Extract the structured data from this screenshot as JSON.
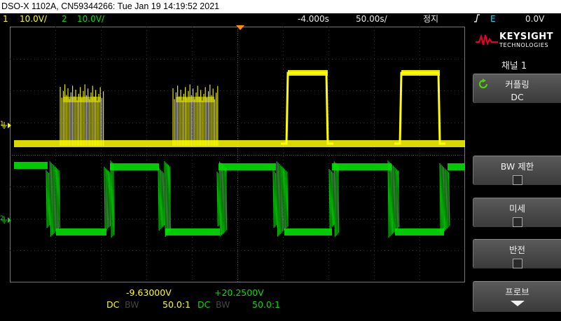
{
  "title": "DSO-X 1102A, CN59344266: Tue Jan 19 14:19:52 2021",
  "status": {
    "ch1_num": "1",
    "ch1_scale": "10.0V/",
    "ch2_num": "2",
    "ch2_scale": "10.0V/",
    "time_offset": "-4.000s",
    "time_scale": "50.00s/",
    "run_state": "정지",
    "trigger_icon": "trigger-edge-icon",
    "trigger_source": "E",
    "trigger_level": "0.0V"
  },
  "brand": {
    "name": "KEYSIGHT",
    "sub": "TECHNOLOGIES",
    "color": "#e4002b"
  },
  "menu": {
    "title": "채널 1",
    "coupling_label": "커플링",
    "coupling_value": "DC",
    "bw_label": "BW 제한",
    "fine_label": "미세",
    "invert_label": "반전",
    "probe_label": "프로브"
  },
  "footer": {
    "ch1_offset": "-9.63000V",
    "ch2_offset": "+20.2500V",
    "ch1_coupling": "DC",
    "ch1_bw": "BW",
    "ch1_probe": "50.0:1",
    "ch2_coupling": "DC",
    "ch2_bw": "BW",
    "ch2_probe": "50.0:1"
  },
  "colors": {
    "ch1": "#ffff00",
    "ch2": "#00e000",
    "trigger": "#00e0ff"
  }
}
